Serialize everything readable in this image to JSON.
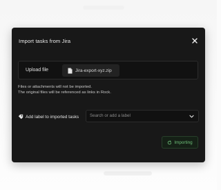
{
  "modal": {
    "title": "Import tasks from Jira",
    "close_icon": "close-icon"
  },
  "upload": {
    "button_label": "Upload file",
    "file_name": "Jira-export-xyz.zip",
    "file_icon": "file-icon"
  },
  "note": {
    "line1": "Files or attachments will not be imported.",
    "line2": "The original files will be referenced as links in Rock."
  },
  "label_section": {
    "title": "Add label to imported tasks",
    "tag_icon": "tag-icon",
    "select_placeholder": "Search or add a label",
    "chevron_icon": "chevron-down-icon"
  },
  "footer": {
    "importing_label": "Importing",
    "spinner_icon": "refresh-icon"
  },
  "colors": {
    "modal_bg": "#181818",
    "accent_green": "#6fc07a"
  }
}
